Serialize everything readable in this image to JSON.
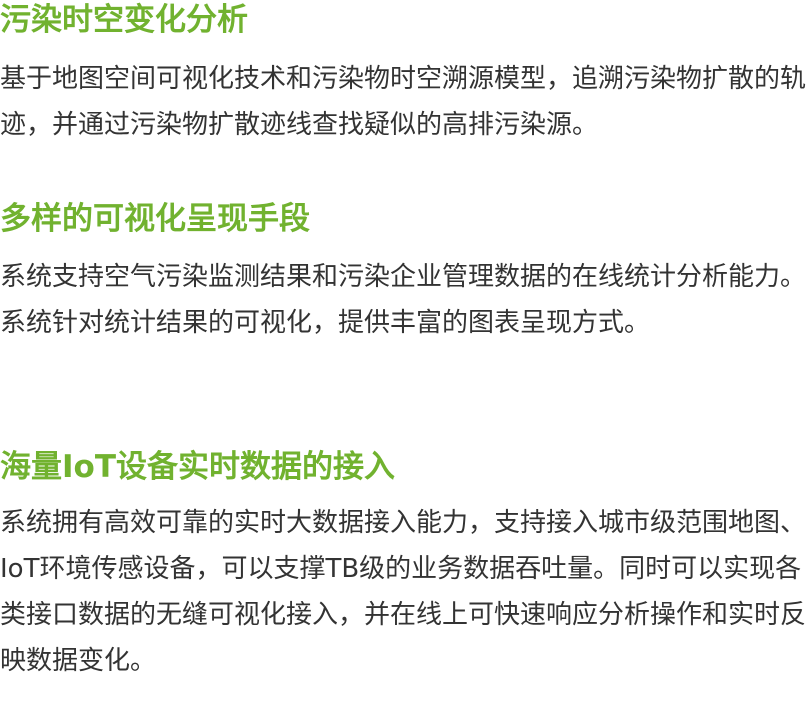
{
  "sections": [
    {
      "heading": "污染时空变化分析",
      "body": "基于地图空间可视化技术和污染物时空溯源模型，追溯污染物扩散的轨迹，并通过污染物扩散迹线查找疑似的高排污染源。"
    },
    {
      "heading": "多样的可视化呈现手段",
      "body": "系统支持空气污染监测结果和污染企业管理数据的在线统计分析能力。系统针对统计结果的可视化，提供丰富的图表呈现方式。"
    },
    {
      "heading": "海量IoT设备实时数据的接入",
      "body": "系统拥有高效可靠的实时大数据接入能力，支持接入城市级范围地图、IoT环境传感设备，可以支撑TB级的业务数据吞吐量。同时可以实现各类接口数据的无缝可视化接入，并在线上可快速响应分析操作和实时反映数据变化。"
    }
  ],
  "colors": {
    "heading": "#71b22f",
    "body": "#333333",
    "background": "#ffffff"
  }
}
